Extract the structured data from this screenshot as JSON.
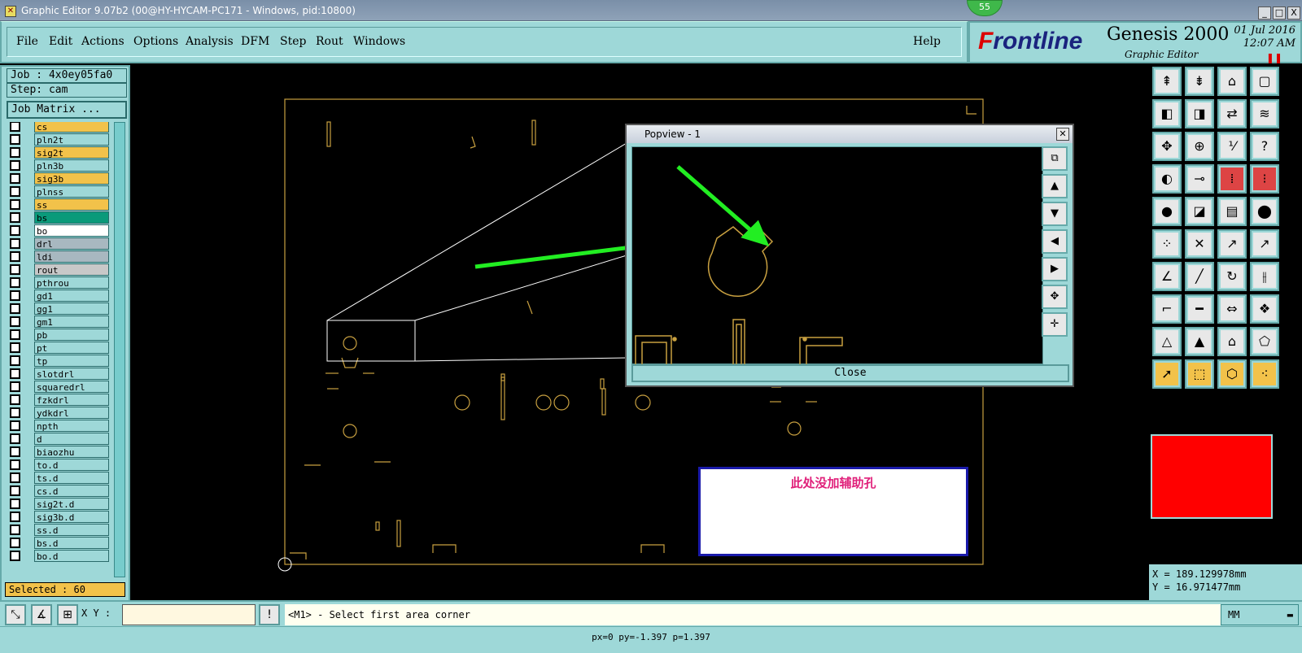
{
  "window": {
    "title": "Graphic Editor 9.07b2 (00@HY-HYCAM-PC171 - Windows, pid:10800)",
    "badge": "55",
    "controls": [
      "_",
      "□",
      "X"
    ]
  },
  "menu": {
    "items": [
      "File",
      "Edit",
      "Actions",
      "Options",
      "Analysis",
      "DFM",
      "Step",
      "Rout",
      "Windows"
    ],
    "help": "Help"
  },
  "logo": {
    "brand_prefix": "F",
    "brand_rest": "rontline",
    "product": "Genesis 2000",
    "subtitle": "Graphic Editor",
    "date": "01 Jul 2016",
    "time": "12:07 AM"
  },
  "left": {
    "job": "Job : 4x0ey05fa0",
    "step": "Step: cam",
    "job_matrix": "Job Matrix ...",
    "selected": "Selected : 60",
    "layers": [
      {
        "name": "cs",
        "color": "#f2c24a"
      },
      {
        "name": "pln2t",
        "color": "#9ed8d8"
      },
      {
        "name": "sig2t",
        "color": "#f2c24a"
      },
      {
        "name": "pln3b",
        "color": "#9ed8d8"
      },
      {
        "name": "sig3b",
        "color": "#f2c24a"
      },
      {
        "name": "plnss",
        "color": "#9ed8d8"
      },
      {
        "name": "ss",
        "color": "#f2c24a"
      },
      {
        "name": "bs",
        "color": "#0a9a7a"
      },
      {
        "name": "bo",
        "color": "#ffffff"
      },
      {
        "name": "drl",
        "color": "#a8b8c0"
      },
      {
        "name": "ldi",
        "color": "#a8b8c0"
      },
      {
        "name": "rout",
        "color": "#c8c8c8"
      },
      {
        "name": "pthrou",
        "color": "#9ed8d8"
      },
      {
        "name": "gd1",
        "color": "#9ed8d8"
      },
      {
        "name": "gg1",
        "color": "#9ed8d8"
      },
      {
        "name": "gm1",
        "color": "#9ed8d8"
      },
      {
        "name": "pb",
        "color": "#9ed8d8"
      },
      {
        "name": "pt",
        "color": "#9ed8d8"
      },
      {
        "name": "tp",
        "color": "#9ed8d8"
      },
      {
        "name": "slotdrl",
        "color": "#9ed8d8"
      },
      {
        "name": "squaredrl",
        "color": "#9ed8d8"
      },
      {
        "name": "fzkdrl",
        "color": "#9ed8d8"
      },
      {
        "name": "ydkdrl",
        "color": "#9ed8d8"
      },
      {
        "name": "npth",
        "color": "#9ed8d8"
      },
      {
        "name": "d",
        "color": "#9ed8d8"
      },
      {
        "name": "biaozhu",
        "color": "#9ed8d8"
      },
      {
        "name": "to.d",
        "color": "#9ed8d8"
      },
      {
        "name": "ts.d",
        "color": "#9ed8d8"
      },
      {
        "name": "cs.d",
        "color": "#9ed8d8"
      },
      {
        "name": "sig2t.d",
        "color": "#9ed8d8"
      },
      {
        "name": "sig3b.d",
        "color": "#9ed8d8"
      },
      {
        "name": "ss.d",
        "color": "#9ed8d8"
      },
      {
        "name": "bs.d",
        "color": "#9ed8d8"
      },
      {
        "name": "bo.d",
        "color": "#9ed8d8"
      }
    ]
  },
  "popview": {
    "title": "Popview - 1",
    "close_label": "Close"
  },
  "note": {
    "text": "此处没加辅助孔"
  },
  "coords": {
    "x": "X = 189.129978mm",
    "y": "Y = 16.971477mm"
  },
  "bottom": {
    "xy_label": "X Y :",
    "xy_value": "",
    "message": "<M1> - Select first area corner",
    "units": "MM",
    "status": "px=0 py=-1.397 p=1.397"
  },
  "colors": {
    "panel": "#9ed8d8",
    "feature": "#c8a040",
    "arrow": "#22ee22",
    "note_text": "#e0207a"
  }
}
